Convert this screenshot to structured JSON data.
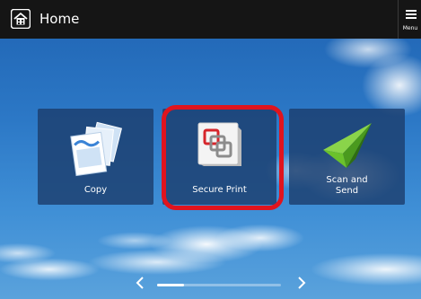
{
  "header": {
    "title": "Home",
    "menu_label": "Menu"
  },
  "tiles": [
    {
      "label": "Copy",
      "icon": "copy-documents-icon"
    },
    {
      "label": "Secure Print",
      "icon": "secure-print-icon",
      "highlighted": true
    },
    {
      "label_line1": "Scan and",
      "label_line2": "Send",
      "icon": "paper-plane-icon"
    }
  ],
  "pager": {
    "position": 0.25
  },
  "colors": {
    "header_bg": "#151515",
    "tile_bg": "#1c3e6e",
    "highlight": "#e0141e",
    "scan_icon": "#6bc22c"
  }
}
